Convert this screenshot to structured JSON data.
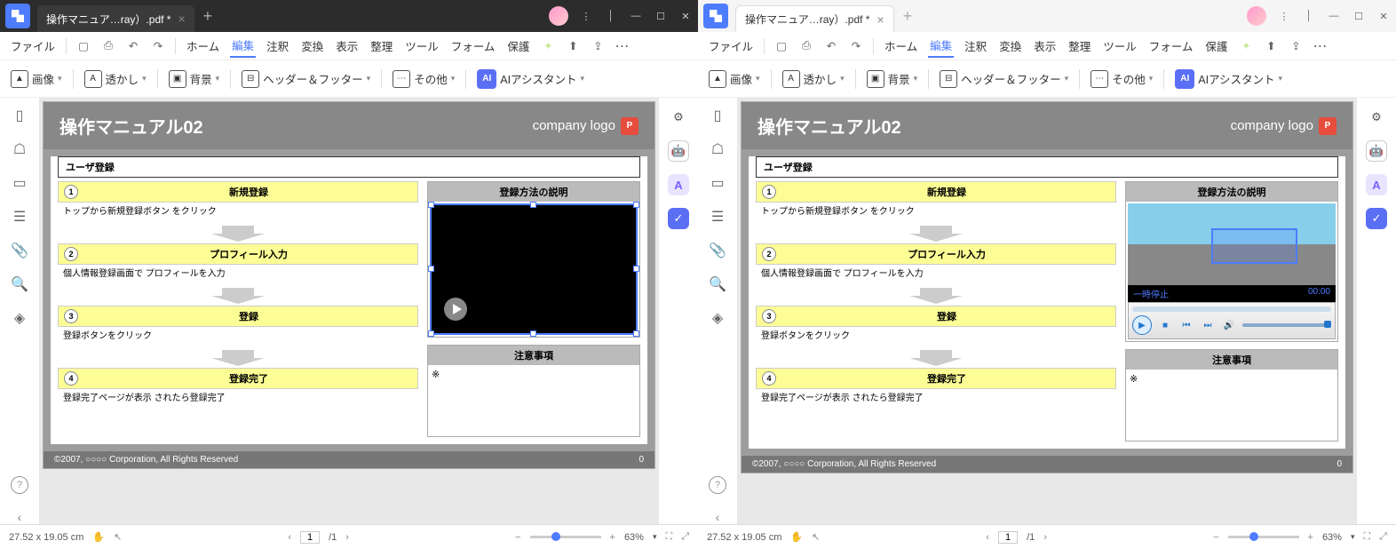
{
  "tab_title": "操作マニュア…ray）.pdf *",
  "menu": {
    "file": "ファイル",
    "items": [
      "ホーム",
      "編集",
      "注釈",
      "変換",
      "表示",
      "整理",
      "ツール",
      "フォーム",
      "保護"
    ],
    "active": 1
  },
  "toolbar": {
    "image": "画像",
    "watermark": "透かし",
    "background": "背景",
    "header_footer": "ヘッダー＆フッター",
    "other": "その他",
    "ai": "AIアシスタント"
  },
  "doc": {
    "title": "操作マニュアル02",
    "company": "company logo",
    "section": "ユーザ登録",
    "steps": [
      {
        "num": "1",
        "title": "新規登録",
        "body": "トップから新規登録ボタン\nをクリック"
      },
      {
        "num": "2",
        "title": "プロフィール入力",
        "body": "個人情報登録画面で\nプロフィールを入力"
      },
      {
        "num": "3",
        "title": "登録",
        "body": "登録ボタンをクリック"
      },
      {
        "num": "4",
        "title": "登録完了",
        "body": "登録完了ページが表示\nされたら登録完了"
      }
    ],
    "panel_explain": "登録方法の説明",
    "panel_caution": "注意事項",
    "caution_body": "※",
    "footer": "©2007, ○○○○ Corporation, All Rights Reserved",
    "page_num": "0"
  },
  "video": {
    "status": "一時停止",
    "time": "00:00"
  },
  "status": {
    "dims": "27.52 x 19.05 cm",
    "page": "1",
    "total": "/1",
    "zoom": "63%"
  }
}
